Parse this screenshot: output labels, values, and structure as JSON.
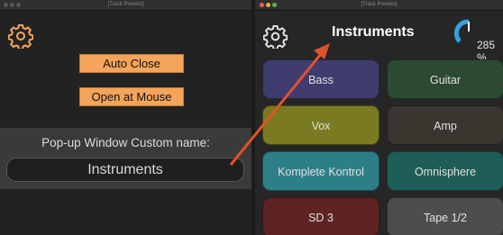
{
  "left_window": {
    "title": "[Track Presets]",
    "auto_close_label": "Auto Close",
    "open_at_mouse_label": "Open at Mouse",
    "custom_name_label": "Pop-up Window Custom name:",
    "custom_name_value": "Instruments"
  },
  "right_window": {
    "title": "[Track Presets]",
    "heading": "Instruments",
    "meter_value": "285 %",
    "pads": [
      {
        "label": "Bass",
        "color": "#3f3c6e"
      },
      {
        "label": "Guitar",
        "color": "#2c4a32"
      },
      {
        "label": "Vox",
        "color": "#7a7a22"
      },
      {
        "label": "Amp",
        "color": "#3b3530"
      },
      {
        "label": "Komplete Kontrol",
        "color": "#2d7f87"
      },
      {
        "label": "Omnisphere",
        "color": "#1f5e58"
      },
      {
        "label": "SD 3",
        "color": "#5e2424"
      },
      {
        "label": "Tape 1/2",
        "color": "#4d4d4d"
      }
    ]
  },
  "colors": {
    "accent_orange": "#f5a55b",
    "arrow_red": "#e0522f",
    "meter_blue": "#35a0e0"
  }
}
